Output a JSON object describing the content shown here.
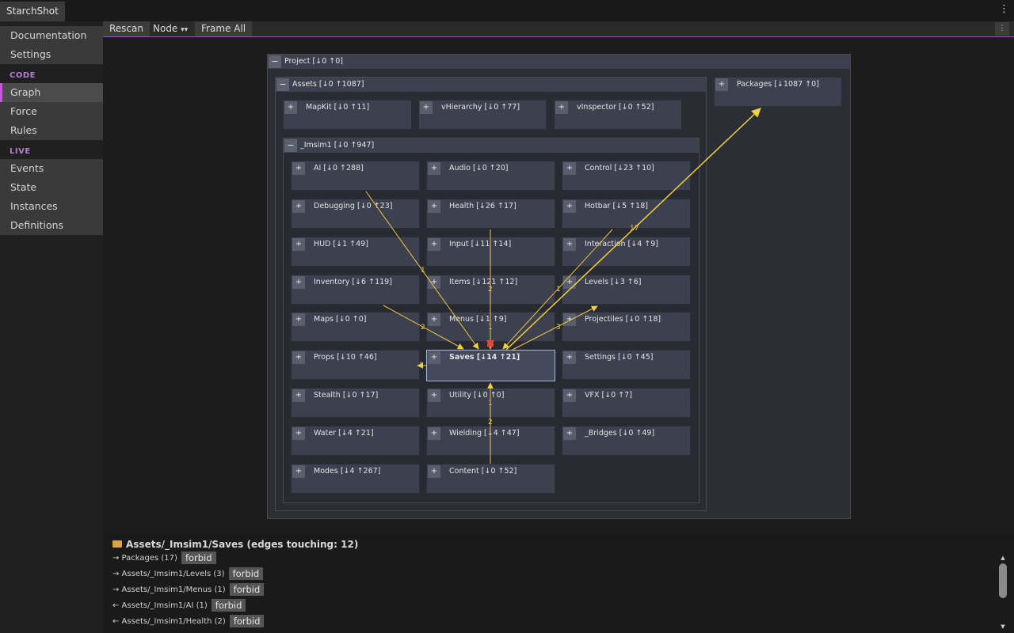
{
  "app": {
    "title": "StarchShot",
    "menu_icon": "kebab-icon"
  },
  "sidebar": {
    "top_items": [
      {
        "label": "Documentation"
      },
      {
        "label": "Settings"
      }
    ],
    "code_header": "CODE",
    "code_items": [
      {
        "label": "Graph",
        "active": true
      },
      {
        "label": "Force"
      },
      {
        "label": "Rules"
      }
    ],
    "live_header": "LIVE",
    "live_items": [
      {
        "label": "Events"
      },
      {
        "label": "State"
      },
      {
        "label": "Instances"
      },
      {
        "label": "Definitions"
      }
    ]
  },
  "toolbar": {
    "rescan": "Rescan",
    "node": "Node",
    "node_arrow": "▾▾",
    "frame_all": "Frame All",
    "menu": "⋮"
  },
  "graph": {
    "project": {
      "toggle": "−",
      "label": "Project  [↓0 ↑0]"
    },
    "assets": {
      "toggle": "−",
      "label": "Assets  [↓0 ↑1087]"
    },
    "packages": {
      "toggle": "+",
      "label": "Packages  [↓1087 ↑0]"
    },
    "imsim": {
      "toggle": "−",
      "label": "_Imsim1  [↓0 ↑947]"
    },
    "asset_nodes": [
      {
        "label": "MapKit  [↓0 ↑11]"
      },
      {
        "label": "vHierarchy  [↓0 ↑77]"
      },
      {
        "label": "vInspector  [↓0 ↑52]"
      }
    ],
    "imsim_nodes": [
      {
        "label": "AI  [↓0 ↑288]"
      },
      {
        "label": "Audio  [↓0 ↑20]"
      },
      {
        "label": "Control  [↓23 ↑10]"
      },
      {
        "label": "Debugging  [↓0 ↑23]"
      },
      {
        "label": "Health  [↓26 ↑17]"
      },
      {
        "label": "Hotbar  [↓5 ↑18]"
      },
      {
        "label": "HUD  [↓1 ↑49]"
      },
      {
        "label": "Input  [↓11 ↑14]"
      },
      {
        "label": "Interaction  [↓4 ↑9]"
      },
      {
        "label": "Inventory  [↓6 ↑119]"
      },
      {
        "label": "Items  [↓121 ↑12]"
      },
      {
        "label": "Levels  [↓3 ↑6]"
      },
      {
        "label": "Maps  [↓0 ↑0]"
      },
      {
        "label": "Menus  [↓1 ↑9]"
      },
      {
        "label": "Projectiles  [↓0 ↑18]"
      },
      {
        "label": "Props  [↓10 ↑46]"
      },
      {
        "label": "Saves  [↓14 ↑21]",
        "selected": true
      },
      {
        "label": "Settings  [↓0 ↑45]"
      },
      {
        "label": "Stealth  [↓0 ↑17]"
      },
      {
        "label": "Utility  [↓0 ↑0]"
      },
      {
        "label": "VFX  [↓0 ↑7]"
      },
      {
        "label": "Water  [↓4 ↑21]"
      },
      {
        "label": "Wielding  [↓4 ↑47]"
      },
      {
        "label": "_Bridges  [↓0 ↑49]"
      },
      {
        "label": "Modes  [↓4 ↑267]"
      },
      {
        "label": "Content  [↓0 ↑52]"
      }
    ],
    "edge_labels": [
      "1",
      "2",
      "17",
      "1",
      "2",
      "1",
      "3",
      "2",
      "1",
      "2"
    ],
    "edge_color": "#f2cf3c"
  },
  "details": {
    "title": "Assets/_Imsim1/Saves   (edges touching: 12)",
    "folder_icon": "folder-icon",
    "edges": [
      {
        "text": "→ Packages   (17)",
        "action": "forbid"
      },
      {
        "text": "→ Assets/_Imsim1/Levels   (3)",
        "action": "forbid"
      },
      {
        "text": "→ Assets/_Imsim1/Menus   (1)",
        "action": "forbid"
      },
      {
        "text": "← Assets/_Imsim1/AI   (1)",
        "action": "forbid"
      },
      {
        "text": "← Assets/_Imsim1/Health   (2)",
        "action": "forbid"
      }
    ]
  }
}
